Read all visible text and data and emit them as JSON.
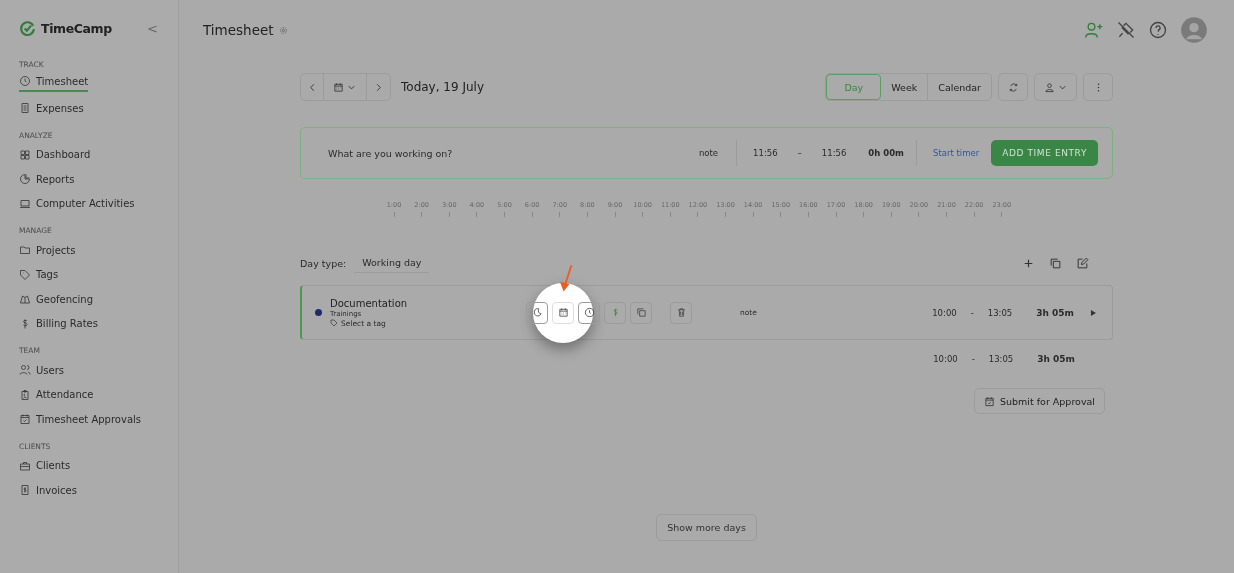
{
  "app": {
    "logo": "TimeCamp",
    "collapse": "<"
  },
  "sidebar": {
    "sections": [
      {
        "label": "TRACK",
        "items": [
          {
            "label": "Timesheet",
            "selected": true
          },
          {
            "label": "Expenses",
            "selected": false
          }
        ]
      },
      {
        "label": "ANALYZE",
        "items": [
          {
            "label": "Dashboard",
            "selected": false
          },
          {
            "label": "Reports",
            "selected": false
          },
          {
            "label": "Computer Activities",
            "selected": false
          }
        ]
      },
      {
        "label": "MANAGE",
        "items": [
          {
            "label": "Projects",
            "selected": false
          },
          {
            "label": "Tags",
            "selected": false
          },
          {
            "label": "Geofencing",
            "selected": false
          },
          {
            "label": "Billing Rates",
            "selected": false
          }
        ]
      },
      {
        "label": "TEAM",
        "items": [
          {
            "label": "Users",
            "selected": false
          },
          {
            "label": "Attendance",
            "selected": false
          },
          {
            "label": "Timesheet Approvals",
            "selected": false
          }
        ]
      },
      {
        "label": "CLIENTS",
        "items": [
          {
            "label": "Clients",
            "selected": false
          },
          {
            "label": "Invoices",
            "selected": false
          }
        ]
      }
    ]
  },
  "header": {
    "title": "Timesheet"
  },
  "toolbar": {
    "date": "Today, 19 July",
    "views": [
      {
        "label": "Day",
        "selected": true
      },
      {
        "label": "Week",
        "selected": false
      },
      {
        "label": "Calendar",
        "selected": false
      }
    ]
  },
  "entry_bar": {
    "placeholder": "What are you working on?",
    "note": "note",
    "start": "11:56",
    "dash": "–",
    "end": "11:56",
    "duration": "0h 00m",
    "start_timer": "Start timer",
    "add": "ADD TIME ENTRY"
  },
  "timeline": [
    "1:00",
    "2:00",
    "3:00",
    "4:00",
    "5:00",
    "6:00",
    "7:00",
    "8:00",
    "9:00",
    "10:00",
    "11:00",
    "12:00",
    "13:00",
    "14:00",
    "15:00",
    "16:00",
    "17:00",
    "18:00",
    "19:00",
    "20:00",
    "21:00",
    "22:00",
    "23:00"
  ],
  "day": {
    "label": "Day type:",
    "value": "Working day"
  },
  "entries": [
    {
      "task": "Documentation",
      "project": "Trainings",
      "tag": "Select a tag",
      "color": "#1f2a6b",
      "note": "note",
      "start": "10:00",
      "dash": "-",
      "end": "13:05",
      "duration": "3h 05m",
      "actions": [
        {
          "kind": "moon",
          "highlighted": false
        },
        {
          "kind": "calendar",
          "highlighted": true
        },
        {
          "kind": "clock",
          "highlighted": false
        },
        {
          "kind": "dollar",
          "highlighted": false
        },
        {
          "kind": "copy",
          "highlighted": false
        },
        {
          "kind": "trash",
          "highlighted": false
        }
      ]
    }
  ],
  "totals": {
    "start": "10:00",
    "dash": "-",
    "end": "13:05",
    "duration": "3h 05m"
  },
  "submit": "Submit for Approval",
  "more": "Show more days"
}
